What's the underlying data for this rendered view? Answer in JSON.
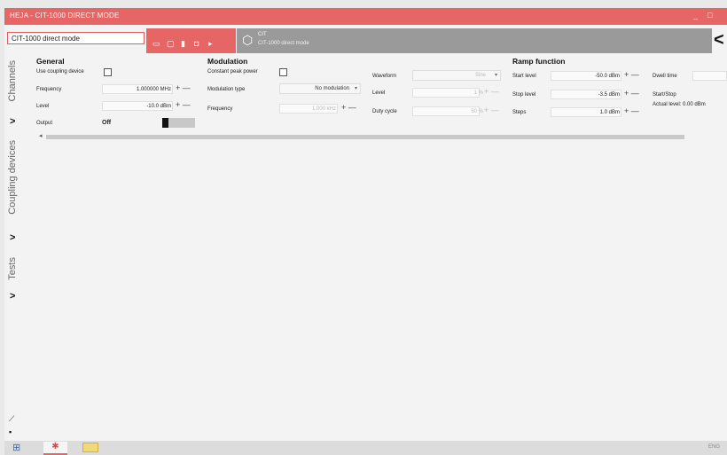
{
  "window": {
    "title": "HEJA - CIT-1000 DIRECT MODE",
    "minimize": "_",
    "maximize": "□"
  },
  "ribbon": {
    "document_name": "CIT-1000 direct mode",
    "device_name": "CIT",
    "device_subtitle": "CIT-1000 direct mode",
    "toolbar_icons": [
      "save-icon",
      "copy-icon",
      "delete-icon",
      "record-icon",
      "play-icon"
    ],
    "collapse_glyph": "<"
  },
  "sidebar": {
    "tabs": [
      {
        "label": "Channels",
        "chevron": ">"
      },
      {
        "label": "Coupling devices",
        "chevron": ">"
      },
      {
        "label": "Tests",
        "chevron": ">"
      }
    ]
  },
  "general": {
    "title": "General",
    "use_coupling_device_label": "Use coupling device",
    "frequency_label": "Frequency",
    "frequency_value": "1.000000 MHz",
    "level_label": "Level",
    "level_value": "-10.0 dBm",
    "output_label": "Output",
    "output_value": "Off"
  },
  "modulation": {
    "title": "Modulation",
    "constant_peak_power_label": "Constant peak power",
    "modulation_type_label": "Modulation type",
    "modulation_type_value": "No modulation",
    "frequency_label": "Frequency",
    "frequency_value": "1.000 kHz",
    "waveform_label": "Waveform",
    "waveform_value": "Sine",
    "level_label": "Level",
    "level_value": "1 %",
    "duty_cycle_label": "Duty cycle",
    "duty_cycle_value": "50 %"
  },
  "ramp": {
    "title": "Ramp function",
    "start_level_label": "Start level",
    "start_level_value": "-50.0 dBm",
    "stop_level_label": "Stop level",
    "stop_level_value": "-3.5 dBm",
    "steps_label": "Steps",
    "steps_value": "1.0 dBm",
    "dwell_time_label": "Dwell time",
    "start_stop_label": "Start/Stop",
    "actual_level_label": "Actual level: 0.00 dBm"
  },
  "taskbar": {
    "tray_text": "ENG"
  }
}
